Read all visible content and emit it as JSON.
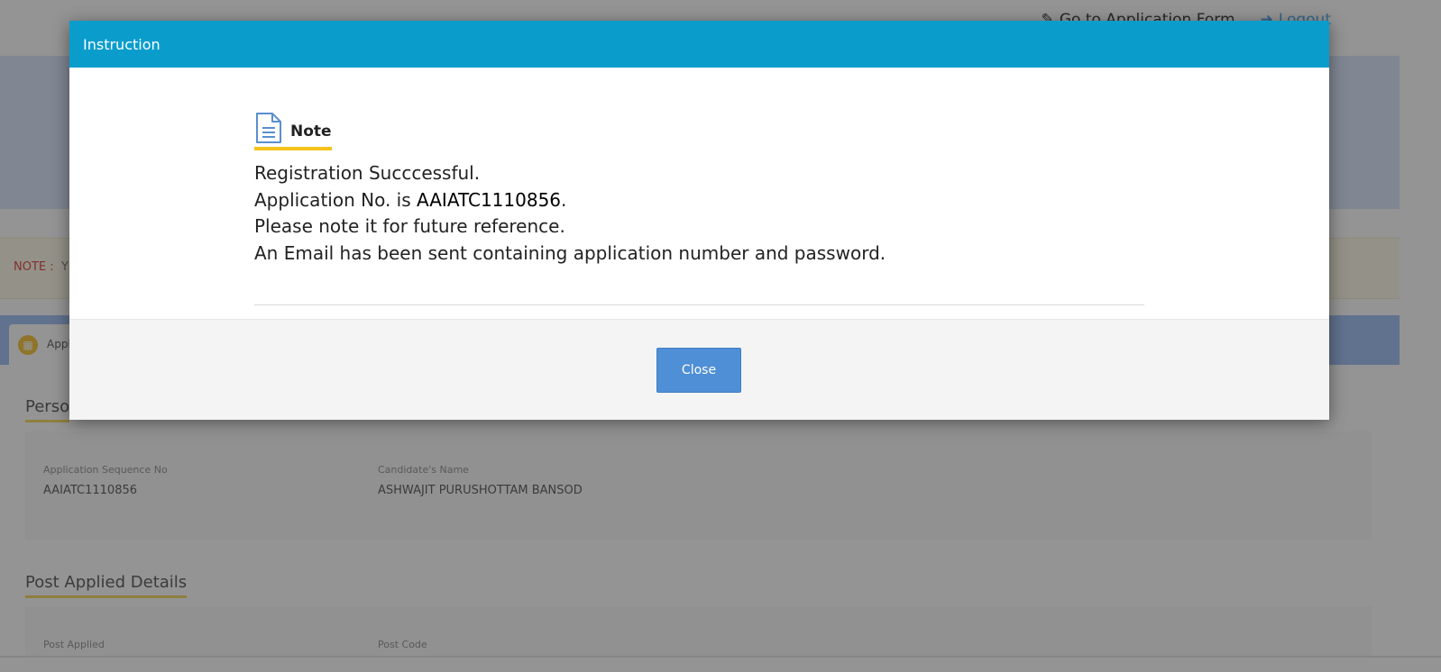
{
  "header": {
    "goto_label": "Go to Application Form",
    "logout_label": "Logout"
  },
  "notice": {
    "label": "NOTE :",
    "text": "Y"
  },
  "tab": {
    "label": "Appl"
  },
  "personal": {
    "title": "Perso",
    "seq_label": "Application Sequence No",
    "seq_value": "AAIATC1110856",
    "name_label": "Candidate's Name",
    "name_value": "ASHWAJIT PURUSHOTTAM BANSOD"
  },
  "post": {
    "title": "Post Applied Details",
    "post_label": "Post Applied",
    "code_label": "Post Code"
  },
  "modal": {
    "title": "Instruction",
    "note_heading": "Note",
    "line1": "Registration Succcessful.",
    "line2_prefix": "Application No. is ",
    "application_no": "AAIATC1110856",
    "line2_suffix": ".",
    "line3": "Please note it for future reference.",
    "line4": "An Email has been sent containing application number and password.",
    "close_label": "Close"
  },
  "colors": {
    "modal_header": "#0a9dcc",
    "close_button": "#4f8fd6",
    "note_underline": "#f5c21b"
  }
}
